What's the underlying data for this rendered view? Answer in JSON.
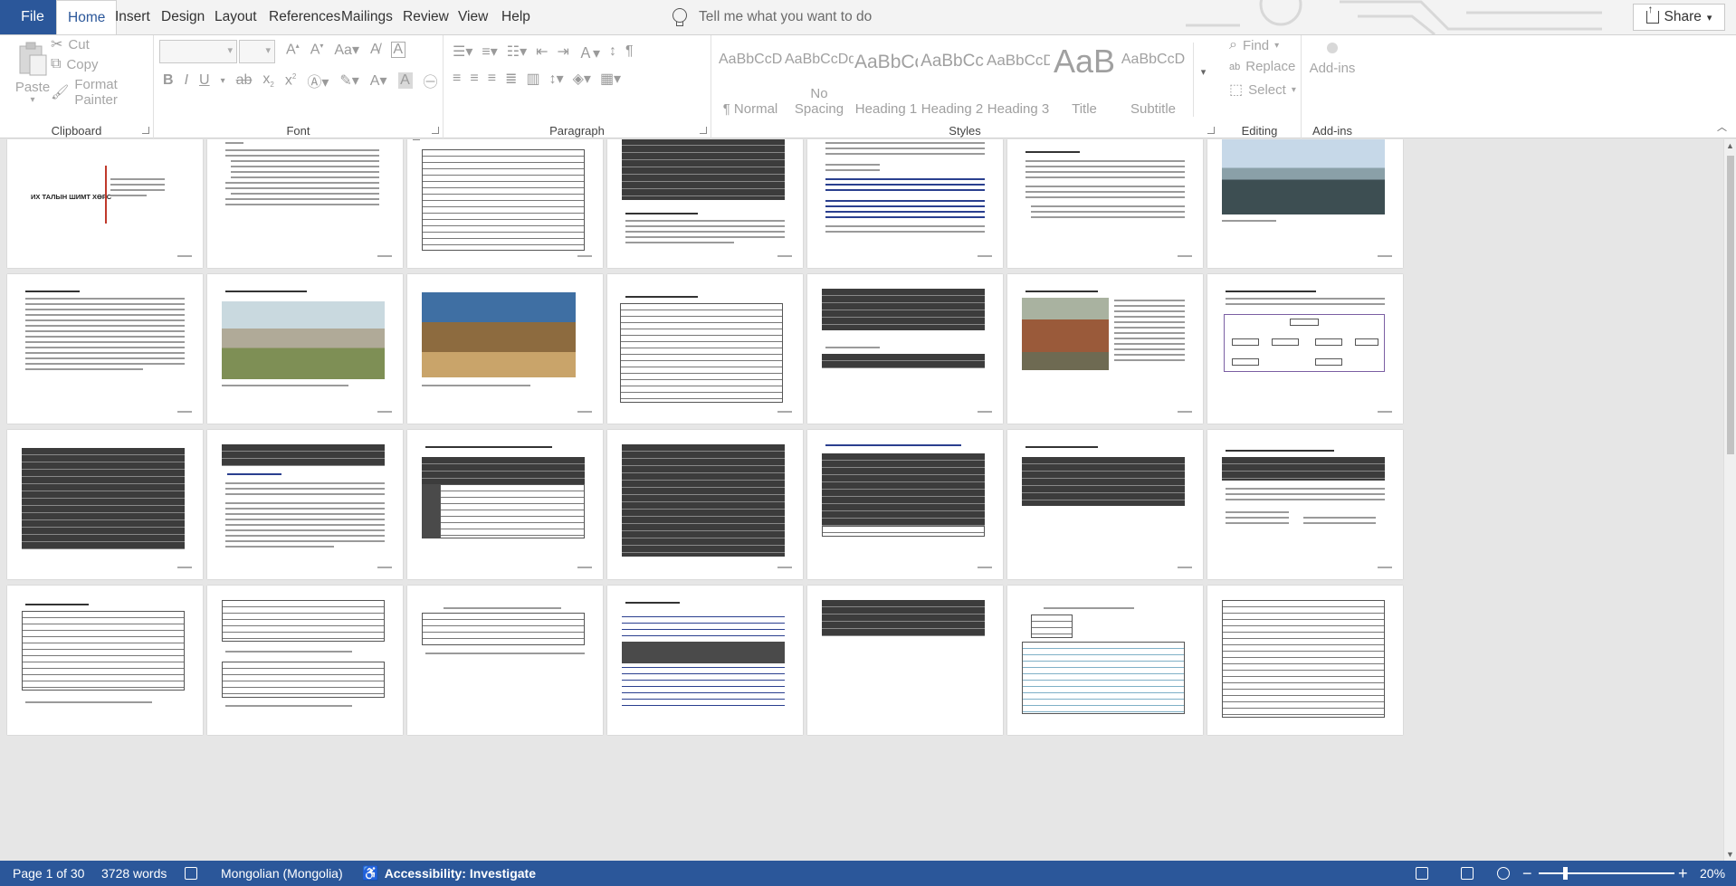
{
  "ribbon_tabs": {
    "file": "File",
    "home": "Home",
    "insert": "Insert",
    "design": "Design",
    "layout": "Layout",
    "references": "References",
    "mailings": "Mailings",
    "review": "Review",
    "view": "View",
    "help": "Help"
  },
  "tell_me": {
    "placeholder": "Tell me what you want to do"
  },
  "share": {
    "label": "Share"
  },
  "clipboard": {
    "group": "Clipboard",
    "paste": "Paste",
    "cut": "Cut",
    "copy": "Copy",
    "format_painter": "Format Painter"
  },
  "font": {
    "group": "Font"
  },
  "paragraph": {
    "group": "Paragraph"
  },
  "styles": {
    "group": "Styles",
    "items": [
      {
        "sample": "AaBbCcDd",
        "name": "¶ Normal"
      },
      {
        "sample": "AaBbCcDd",
        "name": "No Spacing"
      },
      {
        "sample": "AaBbCc",
        "name": "Heading 1"
      },
      {
        "sample": "AaBbCc",
        "name": "Heading 2"
      },
      {
        "sample": "AaBbCcD",
        "name": "Heading 3"
      },
      {
        "sample": "AaB",
        "name": "Title"
      },
      {
        "sample": "AaBbCcD",
        "name": "Subtitle"
      }
    ]
  },
  "editing": {
    "group": "Editing",
    "find": "Find",
    "replace": "Replace",
    "select": "Select"
  },
  "addins": {
    "group": "Add-ins",
    "label": "Add-ins"
  },
  "document": {
    "cover_title": "ИХ ТАЛЫН ШИМТ ХӨРС"
  },
  "status": {
    "page": "Page 1 of 30",
    "words": "3728 words",
    "language": "Mongolian (Mongolia)",
    "accessibility": "Accessibility: Investigate",
    "zoom": "20%"
  },
  "colors": {
    "accent": "#2b579a",
    "ribbon_bg": "#ffffff",
    "doc_bg": "#e6e6e6"
  },
  "icons": {
    "tell_me": "lightbulb-icon",
    "share": "share-icon",
    "find": "magnifier-icon",
    "replace": "replace-icon",
    "select": "cursor-icon"
  }
}
